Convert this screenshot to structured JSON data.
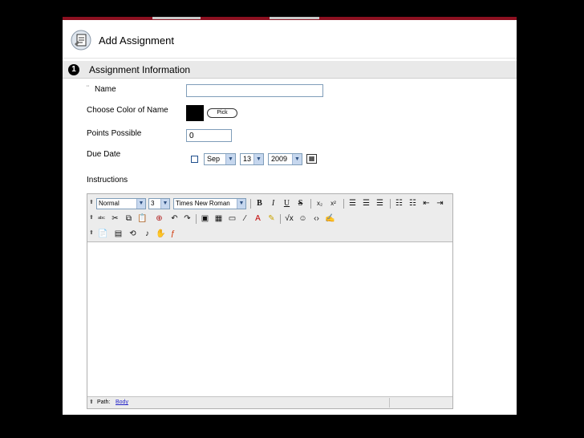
{
  "header": {
    "title": "Add Assignment",
    "logo_icon": "assignment-icon"
  },
  "section": {
    "number": "1",
    "title": "Assignment Information"
  },
  "form": {
    "required_mark": "¨",
    "name_label": "Name",
    "name_value": "",
    "color_label": "Choose Color of Name",
    "color_value": "#000000",
    "pick_label": "Pick",
    "points_label": "Points Possible",
    "points_value": "0",
    "due_label": "Due Date",
    "due_checked": false,
    "due_month": "Sep",
    "due_day": "13",
    "due_year": "2009",
    "instructions_label": "Instructions"
  },
  "editor": {
    "format_value": "Normal",
    "size_value": "3",
    "font_value": "Times New Roman",
    "path_label": "Path:",
    "path_value": "Body"
  }
}
